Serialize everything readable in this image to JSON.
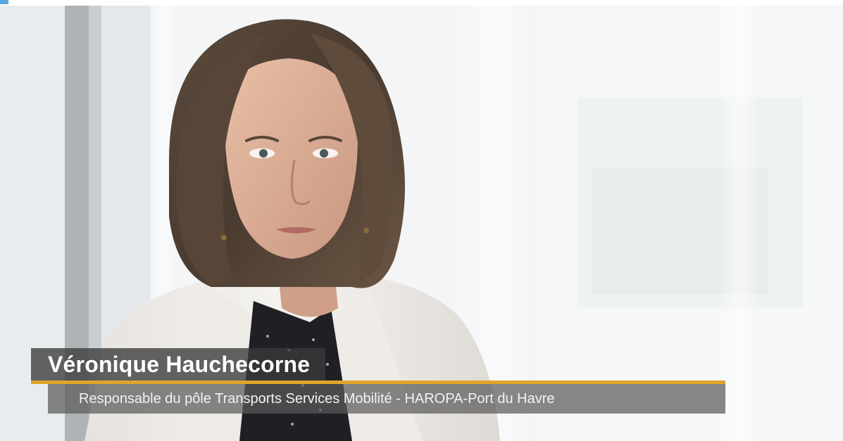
{
  "lower_third": {
    "name": "Véronique Hauchecorne",
    "title": "Responsable du pôle Transports Services Mobilité - HAROPA-Port du Havre"
  },
  "colors": {
    "accent_line": "#e0a52a",
    "name_box": "#3a3a3a",
    "title_box": "#5a5a5a",
    "top_mark": "#5aa6e0"
  }
}
